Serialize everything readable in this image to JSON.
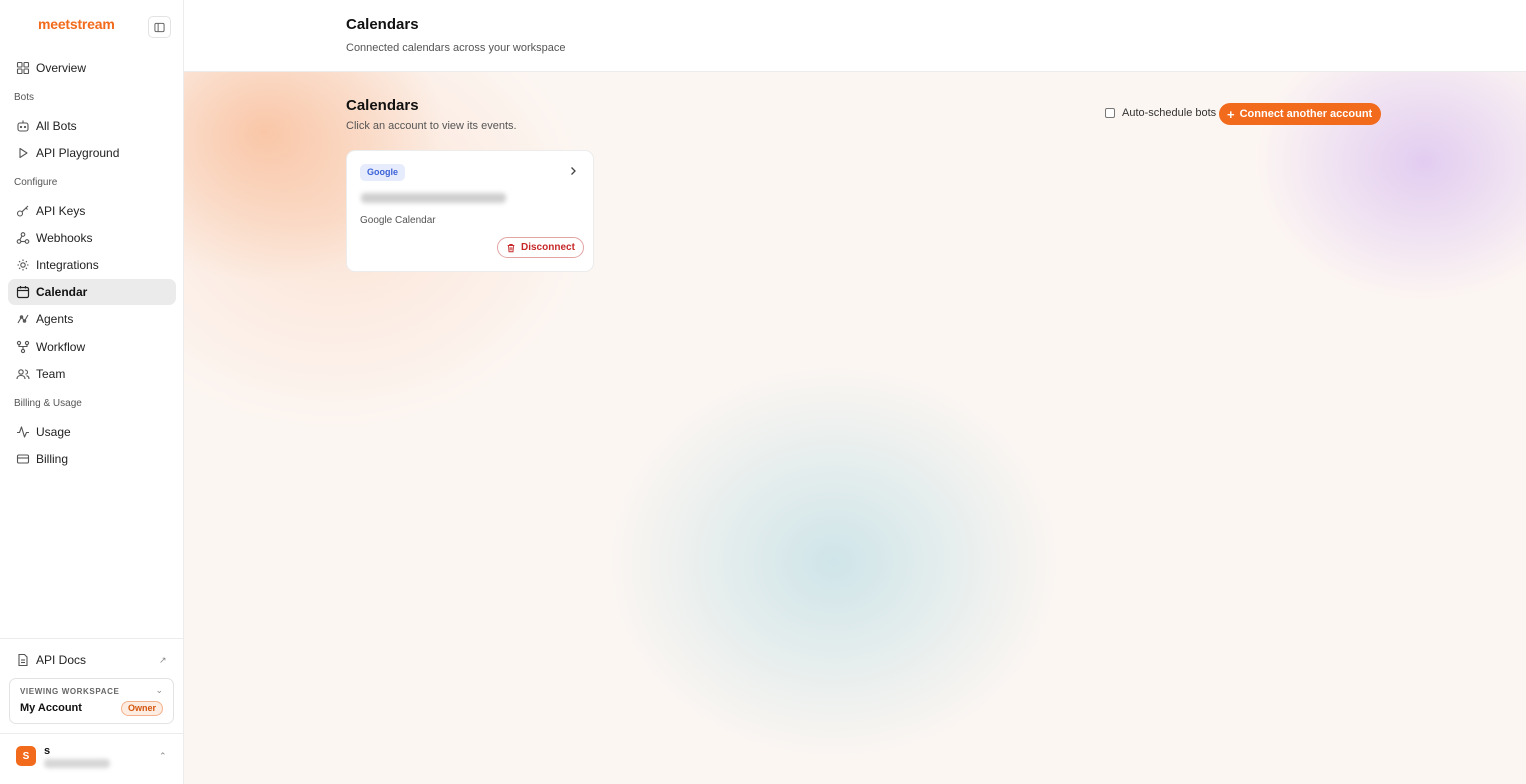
{
  "sidebar": {
    "logo": "meetstream",
    "nav": {
      "overview": "Overview",
      "bots_section": "Bots",
      "all_bots": "All Bots",
      "api_playground": "API Playground",
      "configure_section": "Configure",
      "api_keys": "API Keys",
      "webhooks": "Webhooks",
      "integrations": "Integrations",
      "calendar": "Calendar",
      "agents": "Agents",
      "workflow": "Workflow",
      "team": "Team",
      "billing_section": "Billing & Usage",
      "usage": "Usage",
      "billing": "Billing"
    },
    "api_docs": "API Docs",
    "workspace": {
      "label": "VIEWING WORKSPACE",
      "name": "My Account",
      "role": "Owner"
    },
    "user": {
      "initial": "S",
      "name": "s"
    }
  },
  "header": {
    "title": "Calendars",
    "subtitle": "Connected calendars across your workspace"
  },
  "main": {
    "title": "Calendars",
    "subtitle": "Click an account to view its events.",
    "auto_schedule_label": "Auto-schedule bots",
    "connect_button": "Connect another account",
    "accounts": [
      {
        "provider": "Google",
        "type": "Google Calendar",
        "disconnect_label": "Disconnect"
      }
    ]
  },
  "colors": {
    "accent": "#f26a1b",
    "danger": "#c62828",
    "google_badge": "#3d63d8"
  }
}
